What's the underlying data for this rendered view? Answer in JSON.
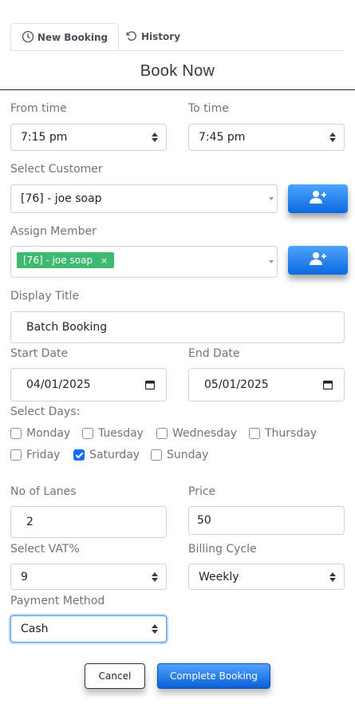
{
  "tabs": [
    {
      "label": "New Booking",
      "icon": "clock-icon",
      "active": true
    },
    {
      "label": "History",
      "icon": "history-icon",
      "active": false
    }
  ],
  "title": "Book Now",
  "from_time": {
    "label": "From time",
    "value": "7:15 pm"
  },
  "to_time": {
    "label": "To time",
    "value": "7:45 pm"
  },
  "customer": {
    "label": "Select Customer",
    "value": "[76] - joe soap",
    "add_icon": "add-user-icon"
  },
  "member": {
    "label": "Assign Member",
    "chip": "[76] - joe soap",
    "remove_glyph": "×",
    "add_icon": "add-user-icon"
  },
  "display_title": {
    "label": "Display Title",
    "value": "Batch Booking"
  },
  "start_date": {
    "label": "Start Date",
    "value": "04/01/2025"
  },
  "end_date": {
    "label": "End Date",
    "value": "05/01/2025"
  },
  "days": {
    "label": "Select Days:",
    "items": [
      {
        "name": "Monday",
        "checked": false
      },
      {
        "name": "Tuesday",
        "checked": false
      },
      {
        "name": "Wednesday",
        "checked": false
      },
      {
        "name": "Thursday",
        "checked": false
      },
      {
        "name": "Friday",
        "checked": false
      },
      {
        "name": "Saturday",
        "checked": true
      },
      {
        "name": "Sunday",
        "checked": false
      }
    ]
  },
  "lanes": {
    "label": "No of Lanes",
    "value": "2"
  },
  "price": {
    "label": "Price",
    "value": "50"
  },
  "vat": {
    "label": "Select VAT%",
    "value": "9"
  },
  "billing": {
    "label": "Billing Cycle",
    "value": "Weekly"
  },
  "payment": {
    "label": "Payment Method",
    "value": "Cash"
  },
  "buttons": {
    "cancel": "Cancel",
    "complete": "Complete Booking"
  },
  "colors": {
    "accent": "#0d6efd",
    "chip": "#3eb970",
    "button_gradient_top": "#4fa3ff",
    "button_gradient_bottom": "#0a6ae0"
  }
}
